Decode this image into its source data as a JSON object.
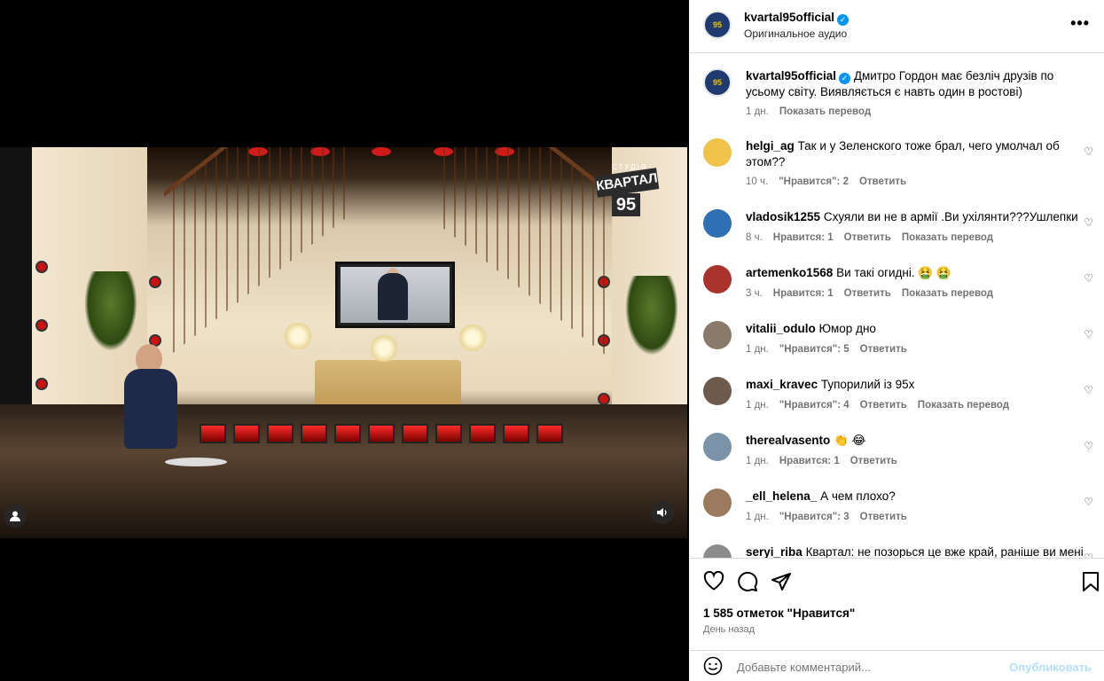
{
  "video": {
    "logo_studio": "СТУДІЯ",
    "logo_main": "КВАРТАЛ",
    "logo_num": "95",
    "user_icon": "user-icon",
    "sound_icon": "speaker-icon"
  },
  "header": {
    "username": "kvartal95official",
    "subtitle": "Оригинальное аудио",
    "avatar_text": "КВАРТАЛ 95",
    "more": "•••"
  },
  "caption": {
    "username": "kvartal95official",
    "text": "Дмитро Гордон має безліч друзів по усьому світу. Виявляється є навть один в ростові)",
    "time": "1 дн.",
    "translate": "Показать перевод"
  },
  "comments": [
    {
      "username": "helgi_ag",
      "text": "Так и у Зеленского тоже брал, чего умолчал об этом??",
      "time": "10 ч.",
      "likes": "\"Нравится\": 2",
      "reply": "Ответить",
      "translate": ""
    },
    {
      "username": "vladosik1255",
      "text": "Схуяли ви не в армії .Ви ухілянти???Ушлепки",
      "time": "8 ч.",
      "likes": "Нравится: 1",
      "reply": "Ответить",
      "translate": "Показать перевод"
    },
    {
      "username": "artemenko1568",
      "text": "Ви такі огидні. 🤮 🤮",
      "time": "3 ч.",
      "likes": "Нравится: 1",
      "reply": "Ответить",
      "translate": "Показать перевод"
    },
    {
      "username": "vitalii_odulo",
      "text": "Юмор дно",
      "time": "1 дн.",
      "likes": "\"Нравится\": 5",
      "reply": "Ответить",
      "translate": ""
    },
    {
      "username": "maxi_kravec",
      "text": "Тупорилий із 95х",
      "time": "1 дн.",
      "likes": "\"Нравится\": 4",
      "reply": "Ответить",
      "translate": "Показать перевод"
    },
    {
      "username": "therealvasento",
      "text": "👏 😂",
      "time": "1 дн.",
      "likes": "Нравится: 1",
      "reply": "Ответить",
      "translate": ""
    },
    {
      "username": "_ell_helena_",
      "text": "А чем плохо?",
      "time": "1 дн.",
      "likes": "\"Нравится\": 3",
      "reply": "Ответить",
      "translate": ""
    },
    {
      "username": "seryi_riba",
      "text": "Квартал: не позорься це вже край, раніше ви мені",
      "time": "",
      "likes": "",
      "reply": "",
      "translate": ""
    }
  ],
  "actions": {
    "likes": "1 585 отметок \"Нравится\"",
    "date": "День назад",
    "comment_placeholder": "Добавьте комментарий...",
    "publish": "Опубликовать"
  },
  "colors": {
    "accent": "#0095f6",
    "publish_disabled": "#b2dffc",
    "meta_gray": "#737373"
  }
}
